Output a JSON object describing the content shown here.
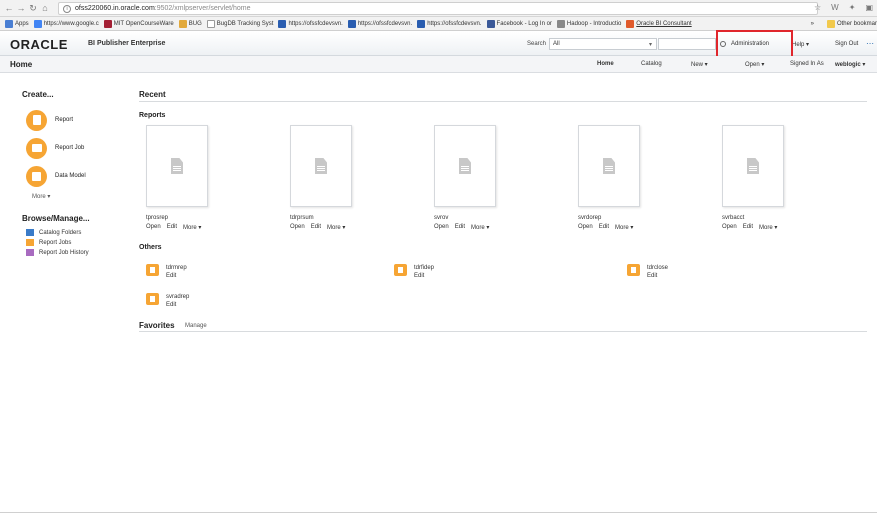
{
  "browser": {
    "url_host": "ofss220060.in.oracle.com",
    "url_path": ":9502/xmlpserver/servlet/home",
    "bookmarks": [
      {
        "label": "Apps",
        "color": "#4a7fd3"
      },
      {
        "label": "https://www.google.c",
        "color": "#4285f4"
      },
      {
        "label": "MIT OpenCourseWare",
        "color": "#a31f34"
      },
      {
        "label": "BUG",
        "color": "#e2a93b"
      },
      {
        "label": "BugDB Tracking Syst",
        "color": "#999999"
      },
      {
        "label": "https://ofssfcdevsvn.",
        "color": "#2a5db0"
      },
      {
        "label": "https://ofssfcdevsvn.",
        "color": "#2a5db0"
      },
      {
        "label": "https://ofssfcdevsvn.",
        "color": "#2a5db0"
      },
      {
        "label": "Facebook - Log In or",
        "color": "#3b5998"
      },
      {
        "label": "Hadoop - Introductio",
        "color": "#888888"
      },
      {
        "label": "Oracle BI Consultant",
        "color": "#e05a2b"
      }
    ],
    "more_bookmarks": "»",
    "other_bookmarks": "Other bookmar"
  },
  "header": {
    "logo": "ORACLE",
    "product": "BI Publisher Enterprise",
    "search_label": "Search",
    "search_scope": "All",
    "admin": "Administration",
    "help": "Help",
    "signout": "Sign Out"
  },
  "homebar": {
    "title": "Home",
    "nav": {
      "home": "Home",
      "catalog": "Catalog",
      "new": "New",
      "open": "Open",
      "signed_in_as": "Signed In As",
      "user": "weblogic"
    }
  },
  "create": {
    "title": "Create...",
    "items": [
      {
        "label": "Report"
      },
      {
        "label": "Report Job"
      },
      {
        "label": "Data Model"
      }
    ],
    "more": "More"
  },
  "browse": {
    "title": "Browse/Manage...",
    "items": [
      {
        "label": "Catalog Folders"
      },
      {
        "label": "Report Jobs"
      },
      {
        "label": "Report Job History"
      }
    ]
  },
  "recent": {
    "title": "Recent",
    "reports_title": "Reports",
    "reports": [
      {
        "name": "tprosrep"
      },
      {
        "name": "tdrprsum"
      },
      {
        "name": "svrov"
      },
      {
        "name": "svrdorep"
      },
      {
        "name": "svrbacct"
      }
    ],
    "actions": {
      "open": "Open",
      "edit": "Edit",
      "more": "More"
    },
    "others_title": "Others",
    "others": [
      {
        "name": "tdrmrep",
        "edit": "Edit"
      },
      {
        "name": "tdrfidep",
        "edit": "Edit"
      },
      {
        "name": "tdrclose",
        "edit": "Edit"
      },
      {
        "name": "svradrep",
        "edit": "Edit"
      }
    ]
  },
  "favorites": {
    "title": "Favorites",
    "manage": "Manage"
  },
  "colors": {
    "accent_orange": "#f6a534",
    "highlight_red": "#e0262c"
  }
}
